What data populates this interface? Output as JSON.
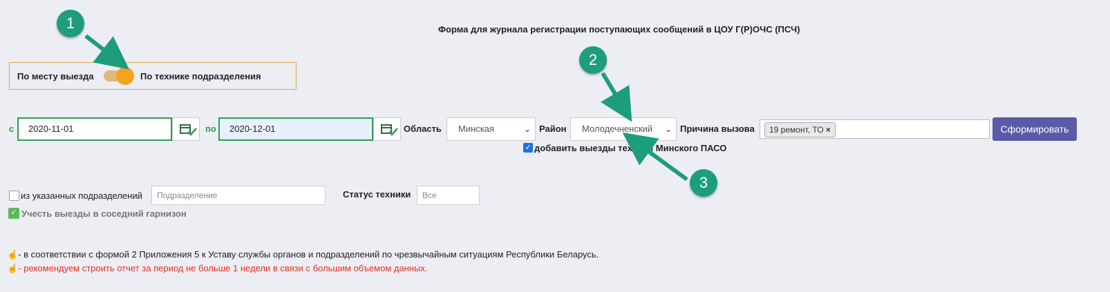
{
  "form_title": "Форма для журнала регистрации поступающих сообщений в ЦОУ Г(Р)ОЧС (ПСЧ)",
  "toggle": {
    "left_label": "По месту выезда",
    "right_label": "По технике подразделения",
    "state": "right"
  },
  "date_from": {
    "label": "с",
    "value": "2020-11-01"
  },
  "date_to": {
    "label": "по",
    "value": "2020-12-01"
  },
  "region": {
    "label": "Область",
    "selected": "Минская"
  },
  "district": {
    "label": "Район",
    "selected": "Молодечненский"
  },
  "reason": {
    "label": "Причина вызова",
    "tags": [
      "19 ремонт, ТО"
    ]
  },
  "submit_label": "Сформировать",
  "add_minsk": {
    "checked": true,
    "label": "добавить выезды техники Минского ПАСО"
  },
  "units": {
    "checked": false,
    "label": "из указанных подразделений",
    "placeholder": "Подразделение"
  },
  "status": {
    "label": "Статус техники",
    "placeholder": "Все"
  },
  "neighbor": {
    "checked": true,
    "label": "Учесть выезды в соседний гарнизон"
  },
  "notes": [
    "- в соответствии с формой 2 Приложения 5 к Уставу службы органов и подразделений по чрезвычайным ситуациям Республики Беларусь.",
    "- рекомендуем строить отчет за период не больше 1 недели в связи с большим объемом данных."
  ],
  "annotations": [
    "1",
    "2",
    "3"
  ],
  "colors": {
    "accent_green": "#28a745",
    "toggle_orange": "#f7a21d",
    "button_purple": "#5a5aa8",
    "warning_red": "#e0301e",
    "badge_teal": "#1d9e7a"
  }
}
